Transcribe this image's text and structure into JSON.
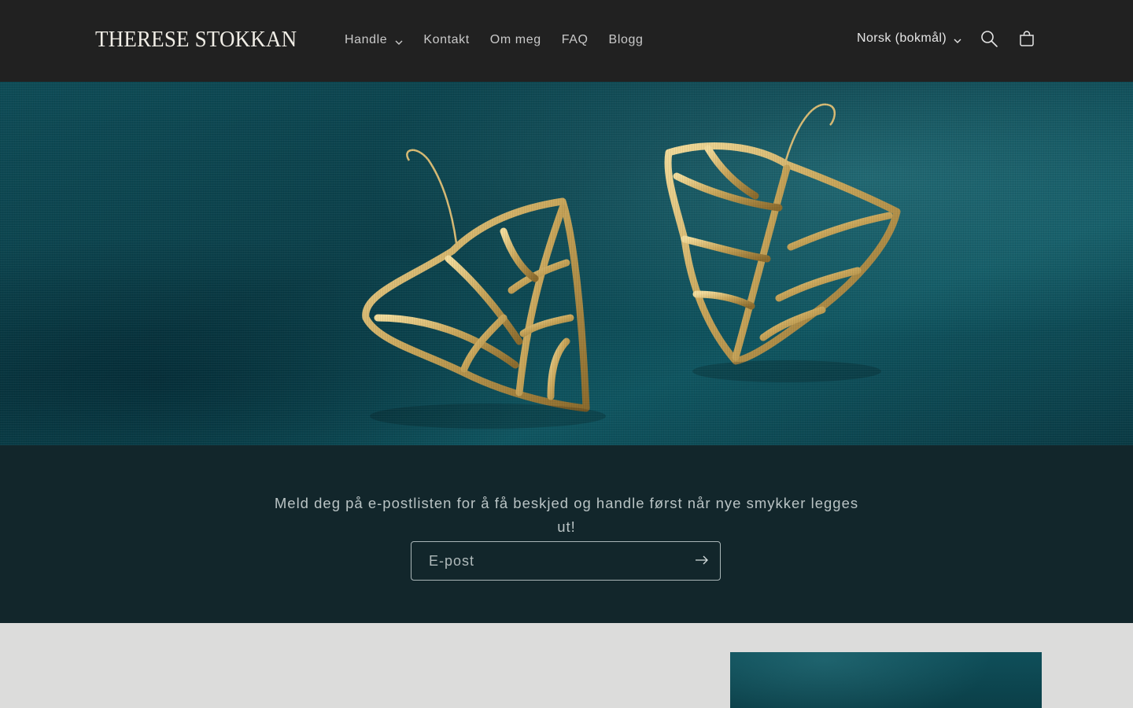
{
  "header": {
    "logo": "THERESE STOKKAN",
    "nav": [
      {
        "label": "Handle",
        "has_dropdown": true
      },
      {
        "label": "Kontakt"
      },
      {
        "label": "Om meg"
      },
      {
        "label": "FAQ"
      },
      {
        "label": "Blogg"
      }
    ],
    "language": "Norsk (bokmål)",
    "icons": {
      "search": "search-icon",
      "cart": "cart-icon"
    }
  },
  "newsletter": {
    "text": "Meld deg på e-postlisten for å få beskjed og handle først når nye smykker legges ut!",
    "placeholder": "E-post",
    "submit_icon": "arrow-right-icon"
  },
  "colors": {
    "header_bg": "#212121",
    "hero_teal": "#0e4c57",
    "newsletter_bg": "#12262b",
    "gold": "#c9a65a",
    "page_bg": "#dcdcdb"
  }
}
